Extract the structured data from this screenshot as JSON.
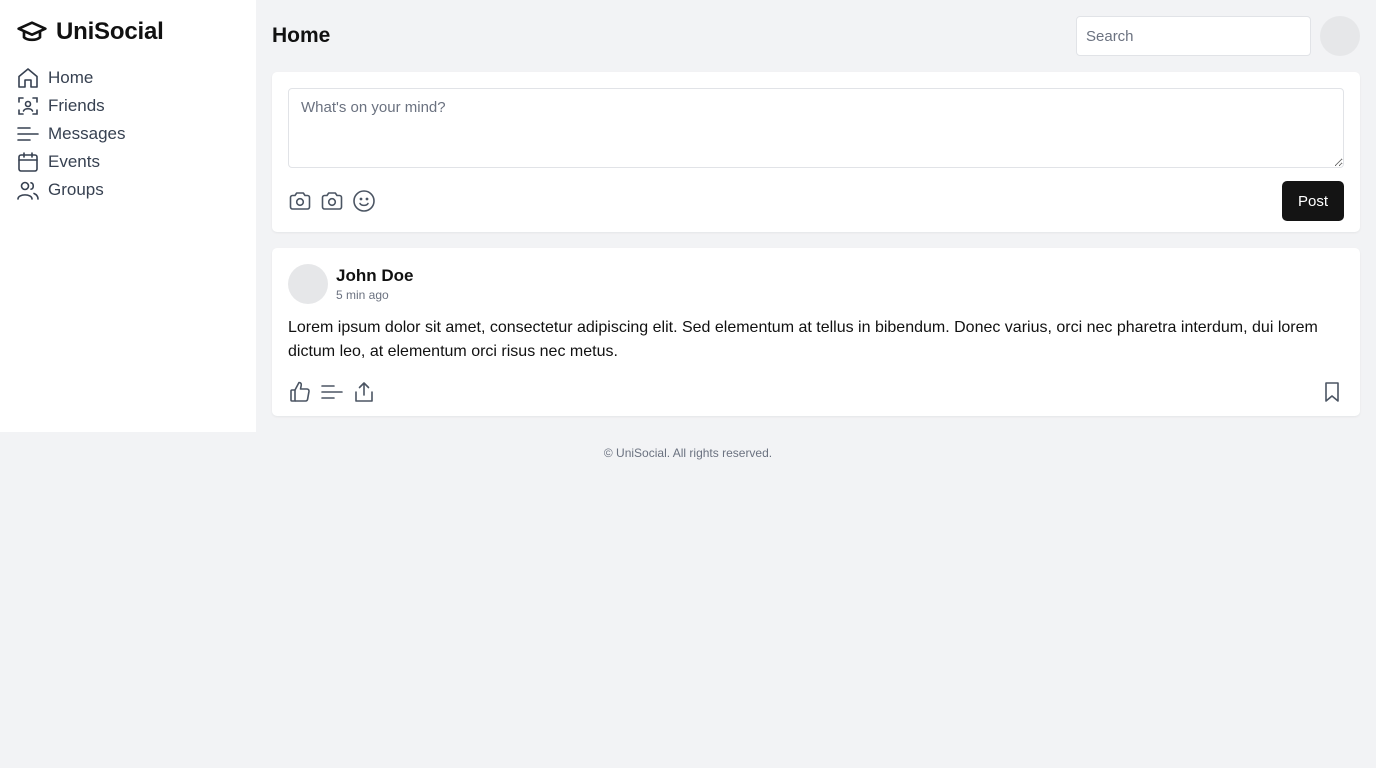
{
  "app": {
    "name": "UniSocial"
  },
  "sidebar": {
    "items": [
      {
        "label": "Home",
        "icon": "home-icon"
      },
      {
        "label": "Friends",
        "icon": "friends-icon"
      },
      {
        "label": "Messages",
        "icon": "messages-icon"
      },
      {
        "label": "Events",
        "icon": "calendar-icon"
      },
      {
        "label": "Groups",
        "icon": "users-icon"
      }
    ]
  },
  "header": {
    "title": "Home",
    "search_placeholder": "Search"
  },
  "composer": {
    "placeholder": "What's on your mind?",
    "post_label": "Post",
    "icons": [
      "camera-icon",
      "camera-icon",
      "emoji-icon"
    ]
  },
  "feed": [
    {
      "author": "John Doe",
      "time": "5 min ago",
      "text": "Lorem ipsum dolor sit amet, consectetur adipiscing elit. Sed elementum at tellus in bibendum. Donec varius, orci nec pharetra interdum, dui lorem dictum leo, at elementum orci risus nec metus.",
      "actions": [
        "like-icon",
        "comment-icon",
        "share-icon",
        "bookmark-icon"
      ]
    }
  ],
  "footer": {
    "text": "© UniSocial. All rights reserved."
  },
  "colors": {
    "background": "#f2f3f5",
    "card": "#ffffff",
    "primary_button": "#141414",
    "muted_text": "#6b7280"
  }
}
